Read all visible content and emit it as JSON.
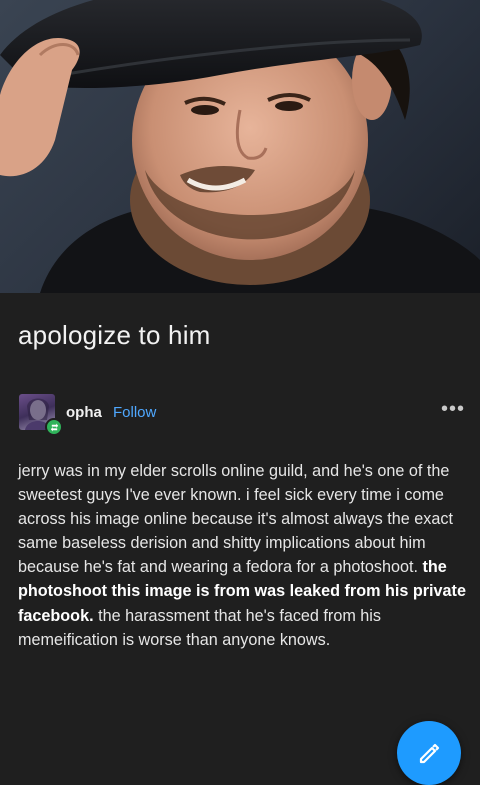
{
  "post": {
    "title": "apologize to him",
    "author": "opha",
    "follow_label": "Follow",
    "more_label": "•••",
    "body_part1": "jerry was in my elder scrolls online guild, and he's one of the sweetest guys I've ever known. i feel sick every time i come across his image online because it's almost always the exact same baseless derision and shitty implications about him because he's fat and wearing a fedora for a photoshoot. ",
    "body_bold": "the photoshoot this image is from was leaked from his private facebook.",
    "body_part2": " the harassment that he's faced from his memeification is worse than anyone knows."
  },
  "icons": {
    "reblog": "reblog-icon",
    "compose": "pencil-icon",
    "more": "more-dots-icon"
  },
  "colors": {
    "background": "#1f1f1f",
    "link": "#4fa8ff",
    "fab": "#1e9bff",
    "reblog_badge": "#2fb35a"
  }
}
